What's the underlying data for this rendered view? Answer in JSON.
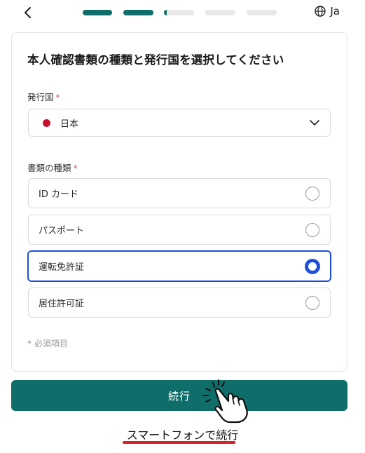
{
  "header": {
    "back_icon": "chevron-left-icon",
    "progress_steps": [
      1,
      1,
      0.1,
      0,
      0
    ],
    "language_icon": "globe-icon",
    "language_label": "Ja"
  },
  "card": {
    "title": "本人確認書類の種類と発行国を選択してください",
    "country": {
      "label": "発行国",
      "required_mark": "*",
      "selected_value": "日本"
    },
    "document": {
      "label": "書類の種類",
      "required_mark": "*",
      "options": [
        {
          "label": "ID カード",
          "selected": false
        },
        {
          "label": "パスポート",
          "selected": false
        },
        {
          "label": "運転免許証",
          "selected": true
        },
        {
          "label": "居住許可証",
          "selected": false
        }
      ]
    },
    "footnote": "* 必須項目"
  },
  "continue_button": {
    "label": "続行"
  },
  "phone_link": {
    "label": "スマートフォンで続行"
  },
  "colors": {
    "primary": "#0f6e6a",
    "selected_border": "#1d4fd8",
    "required": "#e0506a",
    "annotation_underline": "#e01e2a",
    "flag": "#c8102e"
  }
}
